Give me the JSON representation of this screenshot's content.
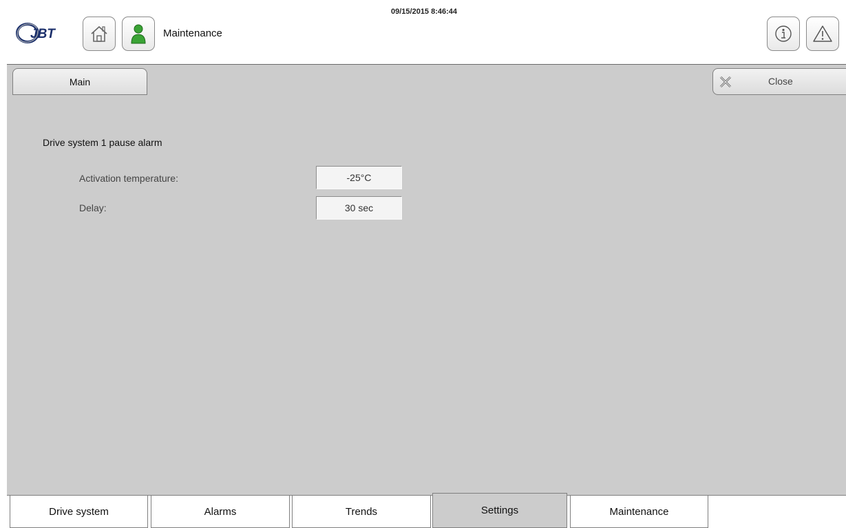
{
  "header": {
    "logo_text": "JBT",
    "title": "Maintenance",
    "datetime": "09/15/2015 8:46:44"
  },
  "tabs_top": {
    "main_label": "Main"
  },
  "close": {
    "label": "Close"
  },
  "section": {
    "title": "Drive system 1 pause alarm",
    "rows": [
      {
        "label": "Activation temperature:",
        "value": "-25°C"
      },
      {
        "label": "Delay:",
        "value": "30 sec"
      }
    ]
  },
  "bottom_tabs": [
    {
      "label": "Drive system",
      "active": false
    },
    {
      "label": "Alarms",
      "active": false
    },
    {
      "label": "Trends",
      "active": false
    },
    {
      "label": "Settings",
      "active": true
    },
    {
      "label": "Maintenance",
      "active": false
    }
  ],
  "colors": {
    "panel": "#cccccc",
    "user_icon": "#3aa335",
    "border": "#7f7f7f"
  },
  "icons": [
    "jbt-logo",
    "home-icon",
    "user-icon",
    "info-icon",
    "warning-icon",
    "close-icon"
  ]
}
